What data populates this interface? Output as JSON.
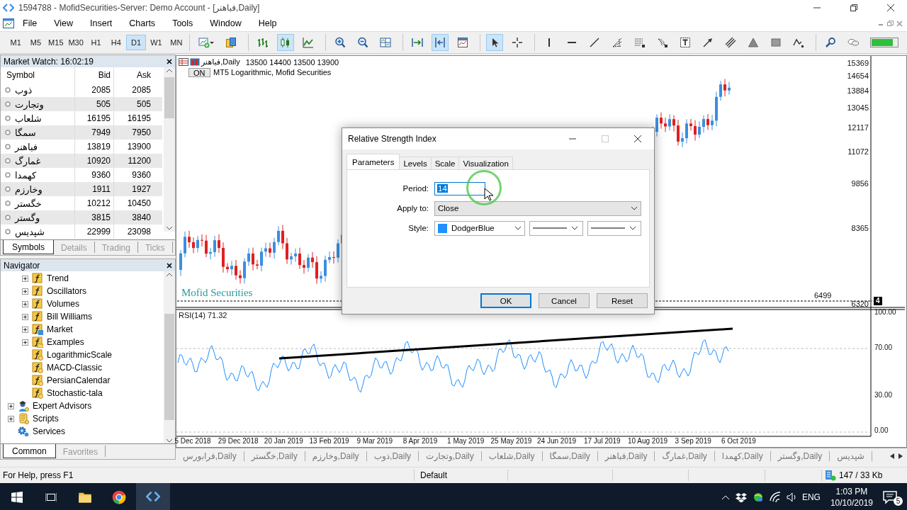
{
  "window": {
    "title": "1594788 - MofidSecurities-Server: Demo Account - [فباهنر,Daily]"
  },
  "menu": [
    "File",
    "View",
    "Insert",
    "Charts",
    "Tools",
    "Window",
    "Help"
  ],
  "toolbar": {
    "timeframes": [
      {
        "label": "M1",
        "selected": false
      },
      {
        "label": "M5",
        "selected": false
      },
      {
        "label": "M15",
        "selected": false
      },
      {
        "label": "M30",
        "selected": false
      },
      {
        "label": "H1",
        "selected": false
      },
      {
        "label": "H4",
        "selected": false
      },
      {
        "label": "D1",
        "selected": true
      },
      {
        "label": "W1",
        "selected": false
      },
      {
        "label": "MN",
        "selected": false
      }
    ],
    "tool_groups": [
      [
        {
          "kind": "new-chart",
          "selected": false
        },
        {
          "kind": "profiles",
          "selected": false
        }
      ],
      [
        {
          "kind": "bar-chart",
          "selected": false
        },
        {
          "kind": "candles",
          "selected": true
        },
        {
          "kind": "line-chart",
          "selected": false
        }
      ],
      [
        {
          "kind": "zoom-in",
          "selected": false
        },
        {
          "kind": "zoom-out",
          "selected": false
        },
        {
          "kind": "tile",
          "selected": false
        }
      ],
      [
        {
          "kind": "shift",
          "selected": false
        },
        {
          "kind": "autoscroll",
          "selected": true
        },
        {
          "kind": "templates",
          "selected": false
        }
      ],
      [
        {
          "kind": "cursor",
          "selected": true
        },
        {
          "kind": "crosshair",
          "selected": false
        }
      ],
      [
        {
          "kind": "vline",
          "selected": false
        },
        {
          "kind": "hline",
          "selected": false
        },
        {
          "kind": "trendline",
          "selected": false
        },
        {
          "kind": "fibo-fan",
          "selected": false
        },
        {
          "kind": "fibo-levels",
          "selected": false
        },
        {
          "kind": "fibo-arc",
          "selected": false
        },
        {
          "kind": "text",
          "selected": false
        },
        {
          "kind": "arrow",
          "selected": false
        },
        {
          "kind": "channel",
          "selected": false
        },
        {
          "kind": "triangle",
          "selected": false
        },
        {
          "kind": "rectangle",
          "selected": false
        },
        {
          "kind": "elliott",
          "selected": false
        }
      ],
      [
        {
          "kind": "search",
          "selected": false
        },
        {
          "kind": "chat",
          "selected": false
        },
        {
          "kind": "signal",
          "selected": false
        }
      ]
    ]
  },
  "market_watch": {
    "title": "Market Watch: 16:02:19",
    "columns": [
      "Symbol",
      "Bid",
      "Ask"
    ],
    "rows": [
      {
        "symbol": "ذوب",
        "bid": "2085",
        "ask": "2085"
      },
      {
        "symbol": "وتجارت",
        "bid": "505",
        "ask": "505"
      },
      {
        "symbol": "شلعاب",
        "bid": "16195",
        "ask": "16195"
      },
      {
        "symbol": "سمگا",
        "bid": "7949",
        "ask": "7950"
      },
      {
        "symbol": "فباهنر",
        "bid": "13819",
        "ask": "13900"
      },
      {
        "symbol": "غمارگ",
        "bid": "10920",
        "ask": "11200"
      },
      {
        "symbol": "کهمدا",
        "bid": "9360",
        "ask": "9360"
      },
      {
        "symbol": "وخارزم",
        "bid": "1911",
        "ask": "1927"
      },
      {
        "symbol": "خگستر",
        "bid": "10212",
        "ask": "10450"
      },
      {
        "symbol": "وگستر",
        "bid": "3815",
        "ask": "3840"
      },
      {
        "symbol": "شپدیس",
        "bid": "22999",
        "ask": "23098"
      }
    ],
    "tabs": [
      {
        "label": "Symbols",
        "selected": true
      },
      {
        "label": "Details",
        "selected": false
      },
      {
        "label": "Trading",
        "selected": false
      },
      {
        "label": "Ticks",
        "selected": false
      }
    ]
  },
  "navigator": {
    "title": "Navigator",
    "items": [
      {
        "children": [
          {
            "label": "Trend",
            "kind": "folder",
            "expanded": false
          },
          {
            "label": "Oscillators",
            "kind": "folder",
            "expanded": false
          },
          {
            "label": "Volumes",
            "kind": "folder",
            "expanded": false
          },
          {
            "label": "Bill Williams",
            "kind": "folder",
            "expanded": false
          },
          {
            "label": "Market",
            "kind": "market",
            "expanded": false
          },
          {
            "label": "Examples",
            "kind": "examples",
            "expanded": false
          },
          {
            "label": "LogarithmicScale",
            "kind": "indicator"
          },
          {
            "label": "MACD-Classic",
            "kind": "indicator"
          },
          {
            "label": "PersianCalendar",
            "kind": "indicator"
          },
          {
            "label": "Stochastic-tala",
            "kind": "indicator"
          }
        ]
      },
      {
        "label": "Expert Advisors",
        "kind": "experts",
        "expanded": false
      },
      {
        "label": "Scripts",
        "kind": "scripts",
        "expanded": false
      },
      {
        "label": "Services",
        "kind": "services"
      }
    ],
    "tabs": [
      {
        "label": "Common",
        "selected": true
      },
      {
        "label": "Favorites",
        "selected": false
      }
    ]
  },
  "chart": {
    "symbol": "فباهنر,Daily",
    "ohlc": "13500 14400 13500 13900",
    "indicator_button": "ON",
    "indicator_label": "MT5 Logarithmic, Mofid Securities",
    "brand_label": "Mofid Securities",
    "price_labels": [
      "15369",
      "14654",
      "13884",
      "13045",
      "12117",
      "11072",
      "9856",
      "8365"
    ],
    "line_label": "6499",
    "low_label": "6320",
    "badge": "4",
    "rsi_label": "RSI(14) 71.32",
    "rsi_levels": [
      "100.00",
      "70.00",
      "30.00",
      "0.00"
    ],
    "dates": [
      "5 Dec 2018",
      "29 Dec 2018",
      "20 Jan 2019",
      "13 Feb 2019",
      "9 Mar 2019",
      "8 Apr 2019",
      "1 May 2019",
      "25 May 2019",
      "24 Jun 2019",
      "17 Jul 2019",
      "10 Aug 2019",
      "3 Sep 2019",
      "6 Oct 2019"
    ]
  },
  "chart_tabs": [
    "فرابورس,Daily",
    "خگستر,Daily",
    "وخارزم,Daily",
    "ذوب,Daily",
    "وتجارت,Daily",
    "شلعاب,Daily",
    "سمگا,Daily",
    "فباهنر,Daily",
    "غمارگ,Daily",
    "کهمدا,Daily",
    "وگستر,Daily",
    "شپدیس"
  ],
  "dialog": {
    "title": "Relative Strength Index",
    "tabs": [
      {
        "label": "Parameters",
        "selected": true
      },
      {
        "label": "Levels",
        "selected": false
      },
      {
        "label": "Scale",
        "selected": false
      },
      {
        "label": "Visualization",
        "selected": false
      }
    ],
    "period_label": "Period:",
    "period": "14",
    "apply_label": "Apply to:",
    "apply_to": "Close",
    "style_label": "Style:",
    "color_name": "DodgerBlue",
    "buttons": [
      {
        "label": "OK",
        "default": true
      },
      {
        "label": "Cancel",
        "default": false
      },
      {
        "label": "Reset",
        "default": false
      }
    ]
  },
  "status_bar": {
    "help": "For Help, press F1",
    "profile": "Default",
    "traffic": "147 / 33 Kb"
  },
  "taskbar": {
    "apps": [
      {
        "kind": "explorer",
        "active": false
      },
      {
        "kind": "browser",
        "active": false
      },
      {
        "kind": "terminal",
        "active": true
      }
    ],
    "language": "ENG",
    "time": "1:03 PM",
    "date": "10/10/2019",
    "notifications": "5"
  }
}
